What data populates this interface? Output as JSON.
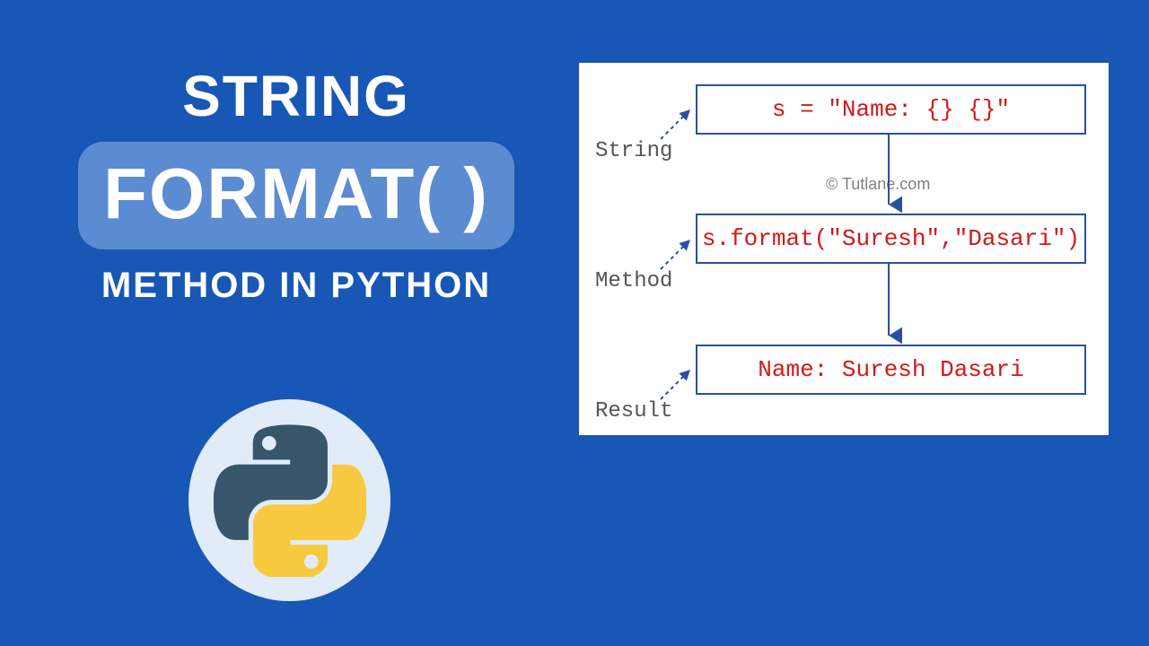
{
  "title": {
    "top": "STRING",
    "pill": "FORMAT( )",
    "bottom": "METHOD IN PYTHON"
  },
  "diagram": {
    "box_string": "s = \"Name: {} {}\"",
    "box_method": "s.format(\"Suresh\",\"Dasari\")",
    "box_result": "Name: Suresh Dasari",
    "label_string": "String",
    "label_method": "Method",
    "label_result": "Result",
    "copyright": "© Tutlane.com"
  },
  "logo_name": "python-logo"
}
